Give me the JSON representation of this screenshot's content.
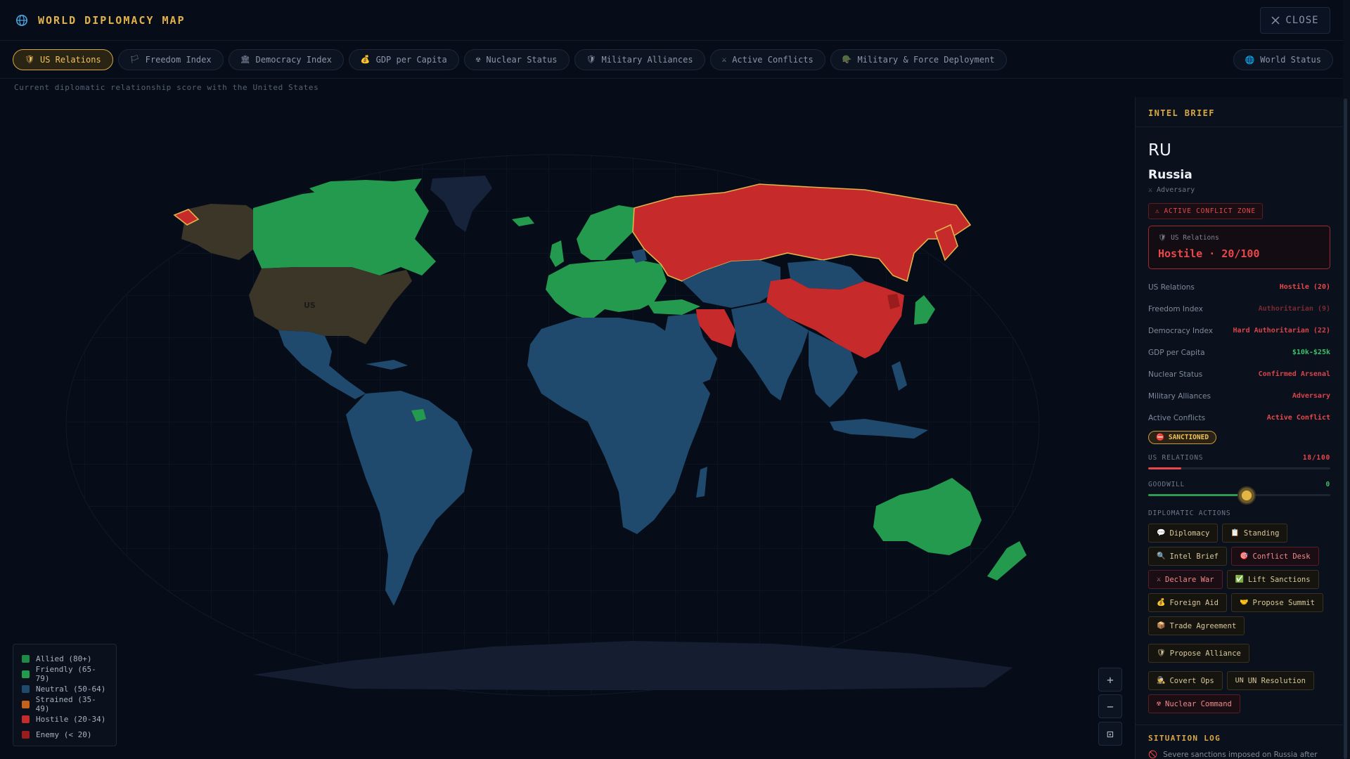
{
  "header": {
    "title": "WORLD DIPLOMACY MAP",
    "close_label": "CLOSE"
  },
  "tabs": [
    {
      "label": "US Relations",
      "icon": "shield-icon",
      "glyph": "🛡"
    },
    {
      "label": "Freedom Index",
      "icon": "flag-icon",
      "glyph": "🏳"
    },
    {
      "label": "Democracy Index",
      "icon": "building-icon",
      "glyph": "🏛"
    },
    {
      "label": "GDP per Capita",
      "icon": "money-bag-icon",
      "glyph": "💰"
    },
    {
      "label": "Nuclear Status",
      "icon": "radiation-icon",
      "glyph": "☢"
    },
    {
      "label": "Military Alliances",
      "icon": "shield-alliance-icon",
      "glyph": "🛡"
    },
    {
      "label": "Active Conflicts",
      "icon": "crossed-swords-icon",
      "glyph": "⚔"
    },
    {
      "label": "Military & Force Deployment",
      "icon": "helmet-icon",
      "glyph": "🪖"
    }
  ],
  "world_status_label": "World Status",
  "subtitle": "Current diplomatic relationship score with the United States",
  "map": {
    "us_label": "US"
  },
  "legend": [
    {
      "label": "Allied (80+)",
      "color": "#1f8a45"
    },
    {
      "label": "Friendly (65-79)",
      "color": "#239a4d"
    },
    {
      "label": "Neutral (50-64)",
      "color": "#1f4a6e"
    },
    {
      "label": "Strained (35-49)",
      "color": "#c4621c"
    },
    {
      "label": "Hostile (20-34)",
      "color": "#c72a2a"
    },
    {
      "label": "Enemy (< 20)",
      "color": "#9b1c1c"
    }
  ],
  "zoom": {
    "in": "+",
    "out": "−",
    "fit": "⊡"
  },
  "panel": {
    "section_title": "INTEL BRIEF",
    "code": "RU",
    "name": "Russia",
    "stance": "Adversary",
    "conflict_badge": "ACTIVE CONFLICT ZONE",
    "relation_card": {
      "label": "US Relations",
      "value": "Hostile · 20/100"
    },
    "stats": [
      {
        "key": "US Relations",
        "value": "Hostile (20)",
        "color": "#e9474a"
      },
      {
        "key": "Freedom Index",
        "value": "Authoritarian (9)",
        "color": "#7a2a30"
      },
      {
        "key": "Democracy Index",
        "value": "Hard Authoritarian (22)",
        "color": "#d9434a"
      },
      {
        "key": "GDP per Capita",
        "value": "$10k-$25k",
        "color": "#3fbf6a"
      },
      {
        "key": "Nuclear Status",
        "value": "Confirmed Arsenal",
        "color": "#d9434a"
      },
      {
        "key": "Military Alliances",
        "value": "Adversary",
        "color": "#d9434a"
      },
      {
        "key": "Active Conflicts",
        "value": "Active Conflict",
        "color": "#e9474a"
      }
    ],
    "sanctioned_badge": "SANCTIONED",
    "us_relations_bar": {
      "label": "US RELATIONS",
      "value_text": "18/100",
      "value": 18
    },
    "goodwill_bar": {
      "label": "GOODWILL",
      "value_text": "0",
      "fill_percent": 54
    },
    "actions_title": "DIPLOMATIC ACTIONS",
    "actions": [
      {
        "label": "Diplomacy",
        "glyph": "💬",
        "icon": "speech-bubble-icon"
      },
      {
        "label": "Standing",
        "glyph": "📋",
        "icon": "clipboard-icon"
      },
      {
        "label": "Intel Brief",
        "glyph": "🔍",
        "icon": "magnifier-icon"
      },
      {
        "label": "Conflict Desk",
        "glyph": "🎯",
        "icon": "target-icon"
      },
      {
        "label": "Declare War",
        "glyph": "⚔",
        "icon": "crossed-swords-icon"
      },
      {
        "label": "Lift Sanctions",
        "glyph": "✅",
        "icon": "checkmark-icon"
      },
      {
        "label": "Foreign Aid",
        "glyph": "💰",
        "icon": "money-bag-icon"
      },
      {
        "label": "Propose Summit",
        "glyph": "🤝",
        "icon": "handshake-icon"
      },
      {
        "label": "Trade Agreement",
        "glyph": "📦",
        "icon": "package-icon"
      },
      {
        "label": "Propose Alliance",
        "glyph": "🛡",
        "icon": "shield-icon"
      },
      {
        "label": "Covert Ops",
        "glyph": "🕵",
        "icon": "spy-icon"
      },
      {
        "label": "UN Resolution",
        "glyph": "UN",
        "icon": "un-icon"
      },
      {
        "label": "Nuclear Command",
        "glyph": "☢",
        "icon": "radiation-icon"
      }
    ],
    "log_title": "SITUATION LOG",
    "log": [
      {
        "text": "Severe sanctions imposed on Russia after the border incursion."
      }
    ]
  },
  "colors": {
    "accent": "#e2b24a",
    "hostile": "#c72a2a",
    "neutral": "#1f4a6e",
    "friendly": "#239a4d",
    "us": "#3b3628"
  }
}
